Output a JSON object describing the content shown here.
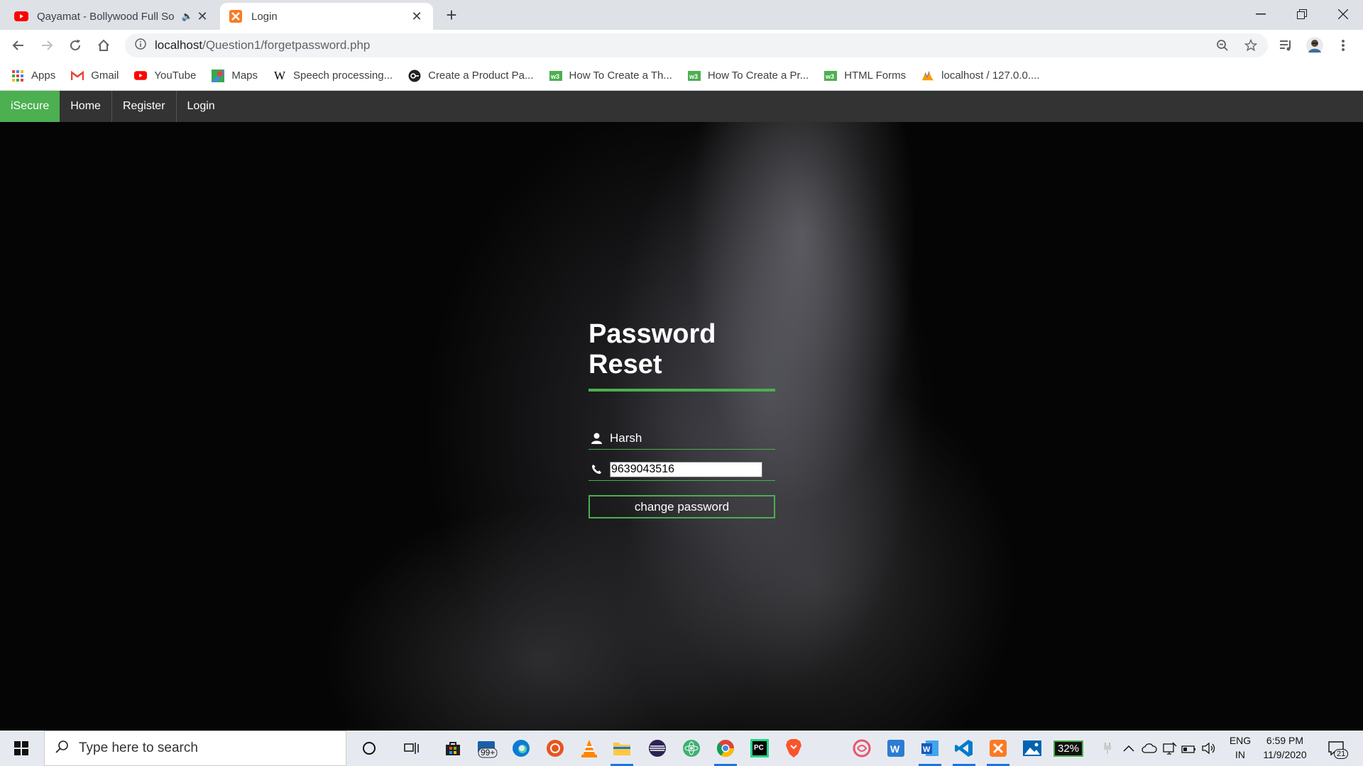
{
  "browser": {
    "tabs": [
      {
        "title": "Qayamat - Bollywood Full So",
        "icon": "youtube-icon",
        "audio": true
      },
      {
        "title": "Login",
        "icon": "xampp-icon",
        "active": true
      }
    ],
    "address": {
      "host": "localhost",
      "path": "/Question1/forgetpassword.php"
    },
    "bookmarks": [
      {
        "label": "Apps",
        "icon": "apps-grid-icon"
      },
      {
        "label": "Gmail",
        "icon": "gmail-icon"
      },
      {
        "label": "YouTube",
        "icon": "youtube-icon"
      },
      {
        "label": "Maps",
        "icon": "maps-icon"
      },
      {
        "label": "Speech processing...",
        "icon": "wikipedia-icon"
      },
      {
        "label": "Create a Product Pa...",
        "icon": "site-icon"
      },
      {
        "label": "How To Create a Th...",
        "icon": "w3schools-icon"
      },
      {
        "label": "How To Create a Pr...",
        "icon": "w3schools-icon"
      },
      {
        "label": "HTML Forms",
        "icon": "w3schools-icon"
      },
      {
        "label": "localhost / 127.0.0....",
        "icon": "phpmyadmin-icon"
      }
    ]
  },
  "site": {
    "nav": {
      "brand": "iSecure",
      "home": "Home",
      "register": "Register",
      "login": "Login"
    },
    "form": {
      "heading": "Password Reset",
      "username": "Harsh",
      "phone": "9639043516",
      "submit": "change password"
    },
    "colors": {
      "accent": "#4caf50",
      "navbar": "#333333"
    }
  },
  "taskbar": {
    "search_placeholder": "Type here to search",
    "mail_badge": "99+",
    "battery": "32%",
    "lang_top": "ENG",
    "lang_bottom": "IN",
    "time": "6:59 PM",
    "date": "11/9/2020",
    "notifications": "21"
  }
}
